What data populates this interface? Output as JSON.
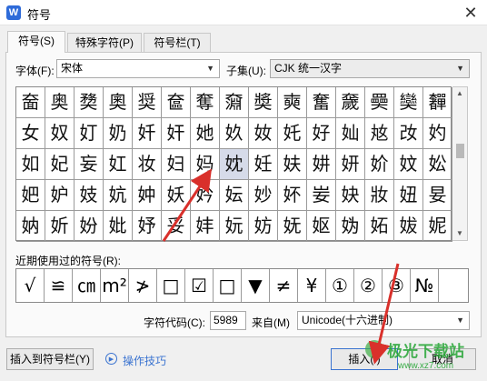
{
  "window": {
    "title": "符号",
    "app_icon_letter": "W",
    "close_glyph": "✕"
  },
  "tabs": [
    {
      "label": "符号(S)",
      "active": true
    },
    {
      "label": "特殊字符(P)",
      "active": false
    },
    {
      "label": "符号栏(T)",
      "active": false
    }
  ],
  "font": {
    "label": "字体(F):",
    "value": "宋体"
  },
  "subset": {
    "label": "子集(U):",
    "value": "CJK 统一汉字"
  },
  "symbol_grid": {
    "rows": [
      [
        "奤",
        "奥",
        "奦",
        "奧",
        "奨",
        "奩",
        "奪",
        "奫",
        "奬",
        "奭",
        "奮",
        "奯",
        "奰",
        "奱",
        "奲"
      ],
      [
        "女",
        "奴",
        "奵",
        "奶",
        "奷",
        "奸",
        "她",
        "奺",
        "奻",
        "奼",
        "好",
        "奾",
        "奿",
        "妀",
        "妁"
      ],
      [
        "如",
        "妃",
        "妄",
        "妅",
        "妆",
        "妇",
        "妈",
        "妉",
        "妊",
        "妋",
        "妌",
        "妍",
        "妎",
        "妏",
        "妐"
      ],
      [
        "妑",
        "妒",
        "妓",
        "妔",
        "妕",
        "妖",
        "妗",
        "妘",
        "妙",
        "妚",
        "妛",
        "妜",
        "妝",
        "妞",
        "妟"
      ],
      [
        "妠",
        "妡",
        "妢",
        "妣",
        "妤",
        "妥",
        "妦",
        "妧",
        "妨",
        "妩",
        "妪",
        "妫",
        "妬",
        "妭",
        "妮"
      ]
    ],
    "selected": {
      "row": 2,
      "col": 7
    }
  },
  "recent": {
    "label": "近期使用过的符号(R):",
    "symbols": [
      "√",
      "≌",
      "㎝",
      "m²",
      "≯",
      "□",
      "☑",
      "□",
      "▼",
      "≠",
      "¥",
      "①",
      "②",
      "③",
      "№",
      ""
    ]
  },
  "char_code": {
    "label": "字符代码(C):",
    "value": "5989"
  },
  "from": {
    "label": "来自(M)",
    "value": "Unicode(十六进制)"
  },
  "buttons": {
    "insert_to_bar": "插入到符号栏(Y)",
    "tips": "操作技巧",
    "insert": "插入(I)",
    "cancel": "取消"
  },
  "watermark": {
    "name": "极光下载站",
    "url": "www.xz7.com"
  },
  "colors": {
    "accent": "#3a73d0",
    "arrow": "#d9302b",
    "selection": "#d6dbe9"
  }
}
